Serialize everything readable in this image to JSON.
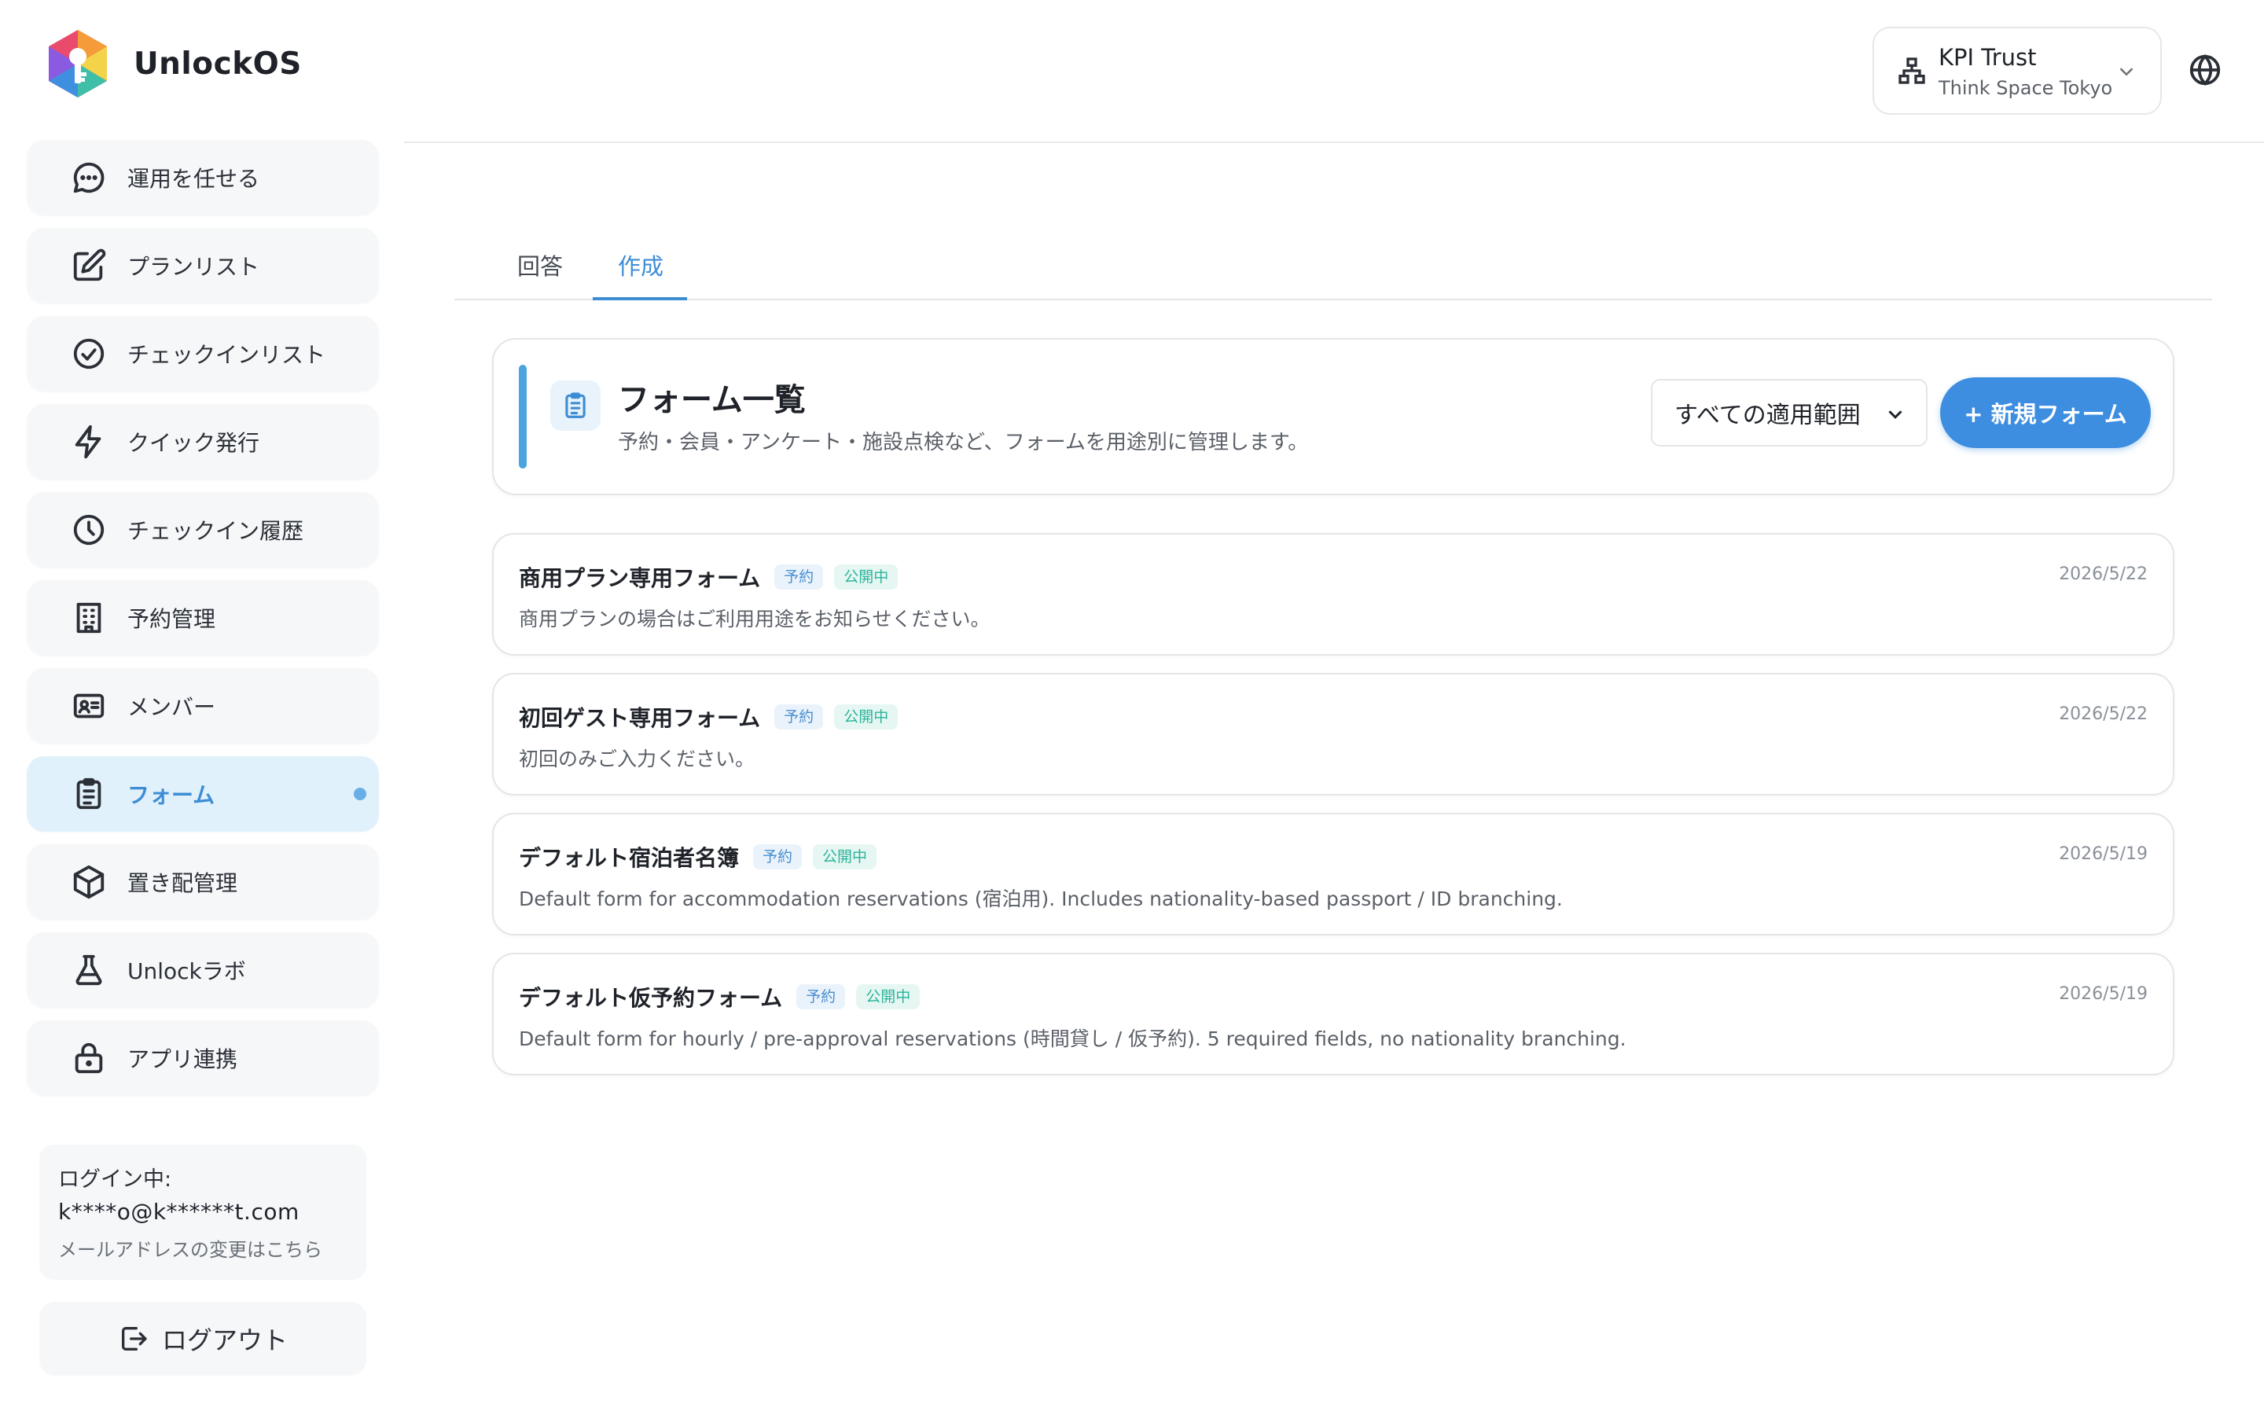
{
  "brand": {
    "name": "UnlockOS"
  },
  "sidebar": {
    "items": [
      {
        "label": "運用を任せる",
        "icon": "chat-icon"
      },
      {
        "label": "プランリスト",
        "icon": "edit-icon"
      },
      {
        "label": "チェックインリスト",
        "icon": "check-circle-icon"
      },
      {
        "label": "クイック発行",
        "icon": "bolt-icon"
      },
      {
        "label": "チェックイン履歴",
        "icon": "clock-icon"
      },
      {
        "label": "予約管理",
        "icon": "building-icon"
      },
      {
        "label": "メンバー",
        "icon": "id-card-icon"
      },
      {
        "label": "フォーム",
        "icon": "clipboard-icon",
        "active": true
      },
      {
        "label": "置き配管理",
        "icon": "box-icon"
      },
      {
        "label": "Unlockラボ",
        "icon": "flask-icon"
      },
      {
        "label": "アプリ連携",
        "icon": "lock-icon"
      }
    ],
    "login": {
      "label": "ログイン中:",
      "email": "k****o@k******t.com",
      "change_link": "メールアドレスの変更はこちら"
    },
    "logout_label": "ログアウト"
  },
  "header": {
    "org_name": "KPI Trust",
    "org_sub": "Think Space Tokyo"
  },
  "tabs": [
    {
      "label": "回答"
    },
    {
      "label": "作成",
      "active": true
    }
  ],
  "panel": {
    "title": "フォーム一覧",
    "subtitle": "予約・会員・アンケート・施設点検など、フォームを用途別に管理します。",
    "scope_select": "すべての適用範囲",
    "new_button": "+ 新規フォーム"
  },
  "forms": [
    {
      "name": "商用プラン専用フォーム",
      "type": "予約",
      "status": "公開中",
      "date": "2026/5/22",
      "description": "商用プランの場合はご利用用途をお知らせください。"
    },
    {
      "name": "初回ゲスト専用フォーム",
      "type": "予約",
      "status": "公開中",
      "date": "2026/5/22",
      "description": "初回のみご入力ください。"
    },
    {
      "name": "デフォルト宿泊者名簿",
      "type": "予約",
      "status": "公開中",
      "date": "2026/5/19",
      "description": "Default form for accommodation reservations (宿泊用). Includes nationality-based passport / ID branching."
    },
    {
      "name": "デフォルト仮予約フォーム",
      "type": "予約",
      "status": "公開中",
      "date": "2026/5/19",
      "description": "Default form for hourly / pre-approval reservations (時間貸し / 仮予約). 5 required fields, no nationality branching."
    }
  ],
  "colors": {
    "accent": "#3d8dd4",
    "primary_button": "#3d8ee0",
    "active_nav_bg": "#e1f1fb",
    "status_badge": "#2bb39a"
  }
}
